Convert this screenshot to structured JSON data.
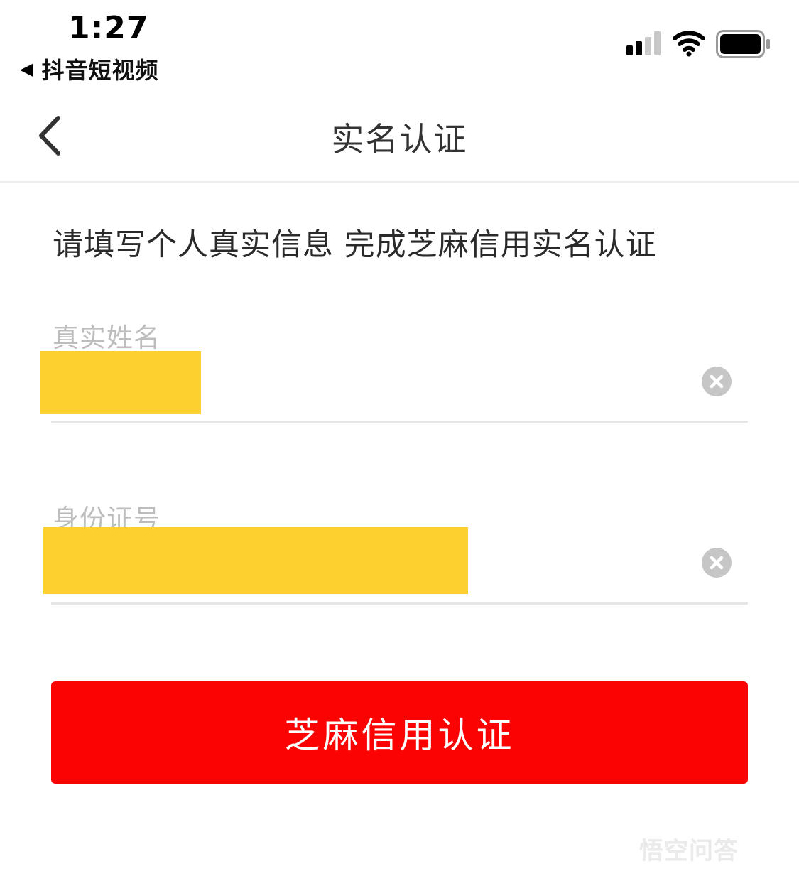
{
  "status_bar": {
    "time": "1:27",
    "back_app_label": "抖音短视频",
    "signal_icon": "cellular-signal-icon",
    "wifi_icon": "wifi-icon",
    "battery_icon": "battery-icon"
  },
  "nav": {
    "title": "实名认证",
    "back_icon": "chevron-left-icon"
  },
  "intro_text": "请填写个人真实信息 完成芝麻信用实名认证",
  "form": {
    "name_field": {
      "label": "真实姓名",
      "value": ""
    },
    "id_field": {
      "label": "身份证号",
      "value": ""
    },
    "clear_icon": "clear-circle-icon",
    "redaction_color": "#fdd030"
  },
  "submit_button": {
    "label": "芝麻信用认证",
    "color": "#fb0303"
  },
  "watermark": {
    "text": "悟空问答"
  },
  "colors": {
    "accent": "#fb0303",
    "label_gray": "#bdbdbd",
    "divider": "#e6e6e6"
  }
}
